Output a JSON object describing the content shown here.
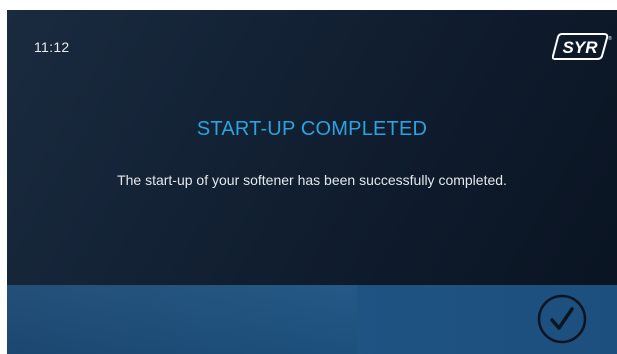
{
  "status_bar": {
    "time": "11:12"
  },
  "brand": {
    "logo_text": "SYR",
    "registered_mark": "®"
  },
  "main": {
    "title": "START-UP COMPLETED",
    "message": "The start-up of your softener has been successfully completed."
  },
  "footer": {
    "confirm_icon": "checkmark-icon"
  },
  "colors": {
    "background": "#101d2f",
    "title": "#2aa3e0",
    "footer": "#1e5382",
    "text": "#e3e7ec"
  }
}
